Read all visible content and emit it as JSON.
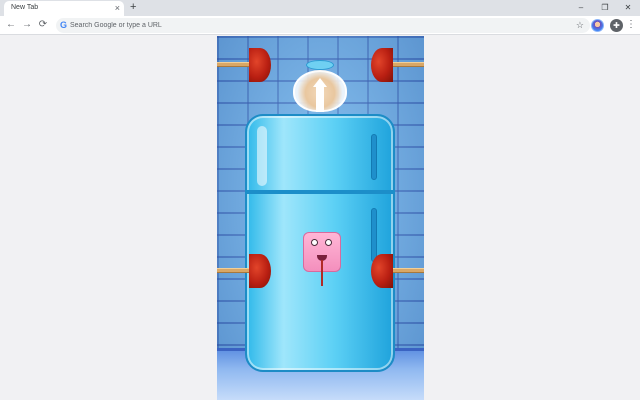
{
  "browser": {
    "tab_title": "New Tab",
    "tab_close_glyph": "×",
    "new_tab_glyph": "+",
    "window_controls": {
      "minimize": "–",
      "restore": "❐",
      "close": "✕"
    },
    "nav": {
      "back": "←",
      "forward": "→",
      "reload": "⟳"
    },
    "omnibox": {
      "placeholder": "Search Google or type a URL",
      "value": "",
      "google_glyph": "G",
      "star_glyph": "☆"
    },
    "extensions_glyph": "✚",
    "menu_glyph": "⋮"
  },
  "game": {
    "sky_color": "#6fb4ea",
    "fridge_color": "#5cd0f5",
    "plunger_color": "#c8281a",
    "monster_color": "#f48fbd"
  }
}
